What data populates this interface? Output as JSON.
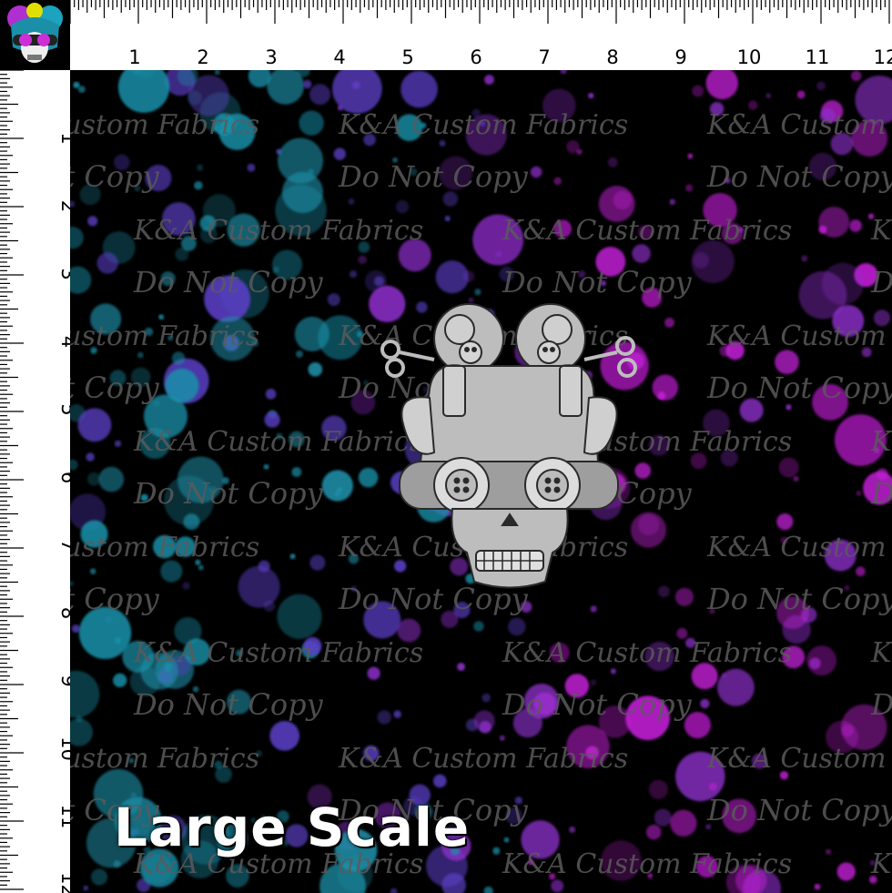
{
  "ruler": {
    "top_numbers": [
      "1",
      "2",
      "3",
      "4",
      "5",
      "6",
      "7",
      "8",
      "9",
      "10",
      "11",
      "12"
    ],
    "left_numbers": [
      "1",
      "2",
      "3",
      "4",
      "5",
      "6",
      "7",
      "8",
      "9",
      "10",
      "11",
      "12"
    ]
  },
  "watermarks": {
    "brand": "K&A Custom Fabrics",
    "notice": "Do Not Copy"
  },
  "scale_label": "Large Scale",
  "colors": {
    "background": "#000000",
    "ruler": "#ffffff",
    "teal": "#1b8fa8",
    "purple": "#8c2fc9",
    "magenta": "#c21fd6",
    "violet": "#5a3fc4",
    "skull": "#bdbdbd"
  },
  "icons": {
    "corner": "skull-logo-icon",
    "motif": "sewing-skull-icon"
  }
}
